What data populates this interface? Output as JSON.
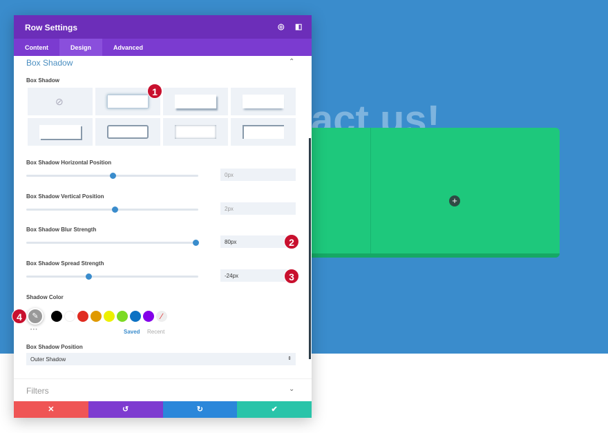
{
  "background": {
    "hero_text": "act us!"
  },
  "panel": {
    "title": "Row Settings",
    "tabs": [
      {
        "label": "Content"
      },
      {
        "label": "Design",
        "active": true
      },
      {
        "label": "Advanced"
      }
    ],
    "section_title": "Box Shadow",
    "box_shadow_label": "Box Shadow",
    "sliders": [
      {
        "label": "Box Shadow Horizontal Position",
        "value": "0px",
        "placeholder": true,
        "level": 0.5
      },
      {
        "label": "Box Shadow Vertical Position",
        "value": "2px",
        "placeholder": true,
        "level": 0.515
      },
      {
        "label": "Box Shadow Blur Strength",
        "value": "80px",
        "placeholder": false,
        "level": 0.985
      },
      {
        "label": "Box Shadow Spread Strength",
        "value": "-24px",
        "placeholder": false,
        "level": 0.36
      }
    ],
    "shadow_color_label": "Shadow Color",
    "swatches": [
      "#000000",
      "#ffffff",
      "#e02b20",
      "#e09900",
      "#edf000",
      "#7cda24",
      "#0c71c3",
      "#8300e9"
    ],
    "saved_label": "Saved",
    "recent_label": "Recent",
    "more": "• • •",
    "position_label": "Box Shadow Position",
    "position_value": "Outer Shadow",
    "filters_label": "Filters"
  },
  "badges": [
    "1",
    "2",
    "3",
    "4"
  ],
  "colors": {
    "header": "#6c2eb9",
    "cancel": "#ef5555",
    "undo": "#7e3bd0",
    "redo": "#2b87da",
    "save": "#29c4a9"
  }
}
